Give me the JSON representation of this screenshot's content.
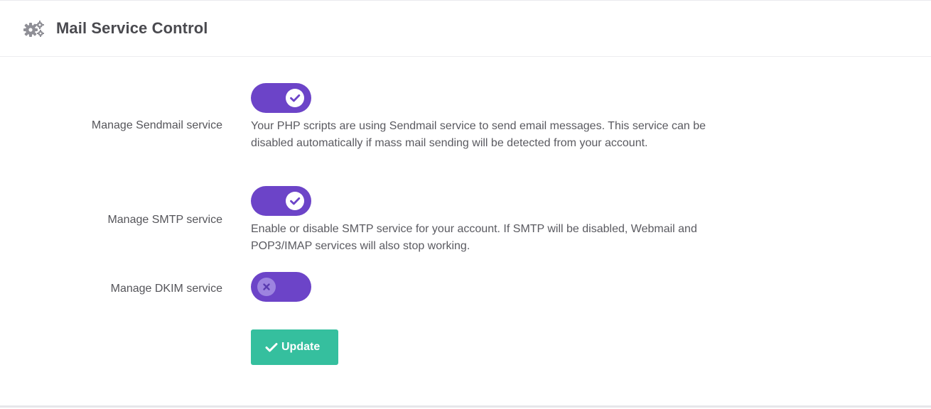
{
  "panel": {
    "title": "Mail Service Control",
    "icon": "gears-icon"
  },
  "accent_color": "#6c44c8",
  "button_color": "#35bf9e",
  "services": [
    {
      "label": "Manage Sendmail service",
      "enabled": true,
      "description": "Your PHP scripts are using Sendmail service to send email messages. This service can be disabled automatically if mass mail sending will be detected from your account."
    },
    {
      "label": "Manage SMTP service",
      "enabled": true,
      "description": "Enable or disable SMTP service for your account. If SMTP will be disabled, Webmail and POP3/IMAP services will also stop working."
    },
    {
      "label": "Manage DKIM service",
      "enabled": false,
      "description": ""
    }
  ],
  "actions": {
    "update_label": "Update",
    "update_icon": "check-icon"
  }
}
